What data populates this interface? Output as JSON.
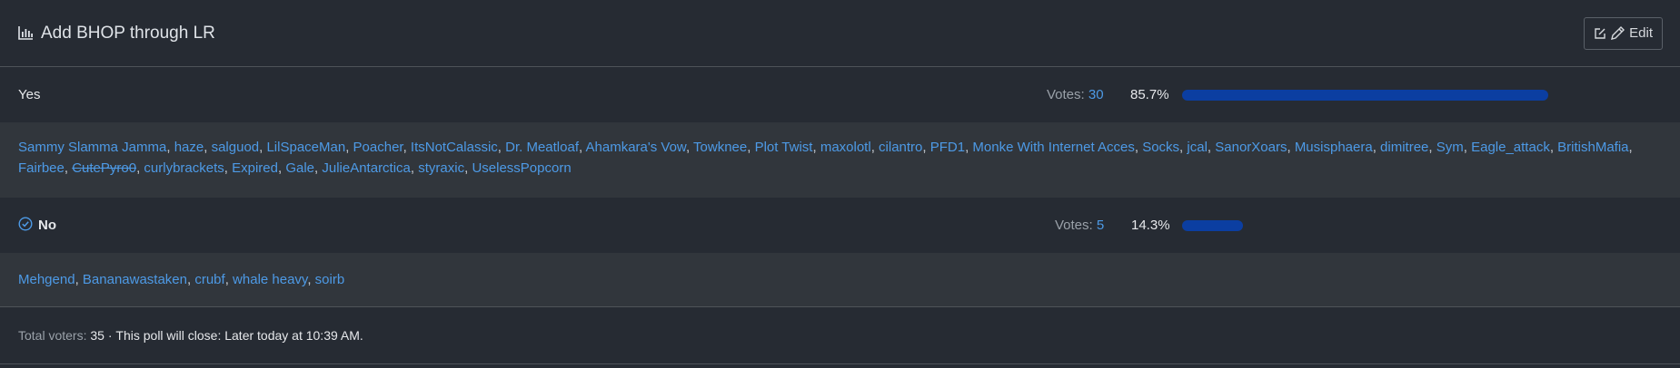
{
  "poll": {
    "title": "Add BHOP through LR",
    "title_icon": "bar-chart-icon",
    "edit_label": "Edit",
    "edit_icons": [
      "edit-square-icon",
      "pencil-icon"
    ]
  },
  "options": [
    {
      "label": "Yes",
      "selected": false,
      "votes_label": "Votes:",
      "votes": "30",
      "percent": "85.7%",
      "fraction": 0.857,
      "voters": [
        "Sammy Slamma Jamma",
        "haze",
        "salguod",
        "LilSpaceMan",
        "Poacher",
        "ItsNotCalassic",
        "Dr. Meatloaf",
        "Ahamkara's Vow",
        "Towknee",
        "Plot Twist",
        "maxolotl",
        "cilantro",
        "PFD1",
        "Monke With Internet Acces",
        "Socks",
        "jcal",
        "SanorXoars",
        "Musisphaera",
        "dimitree",
        "Sym",
        "Eagle_attack",
        "BritishMafia",
        "Fairbee",
        "CutePyro0",
        "curlybrackets",
        "Expired",
        "Gale",
        "JulieAntarctica",
        "styraxic",
        "UselessPopcorn"
      ],
      "struck_voters": [
        "CutePyro0"
      ]
    },
    {
      "label": "No",
      "selected": true,
      "selected_icon": "check-circle-icon",
      "votes_label": "Votes:",
      "votes": "5",
      "percent": "14.3%",
      "fraction": 0.143,
      "voters": [
        "Mehgend",
        "Bananawastaken",
        "crubf",
        "whale heavy",
        "soirb"
      ],
      "struck_voters": []
    }
  ],
  "footer": {
    "total_label": "Total voters:",
    "total": "35",
    "separator": "·",
    "close_label": "This poll will close:",
    "close_value": "Later today at 10:39 AM."
  },
  "colors": {
    "background": "#262b33",
    "voters_background": "#31363c",
    "link": "#4d9ae6",
    "bar": "#0b3ea1"
  }
}
